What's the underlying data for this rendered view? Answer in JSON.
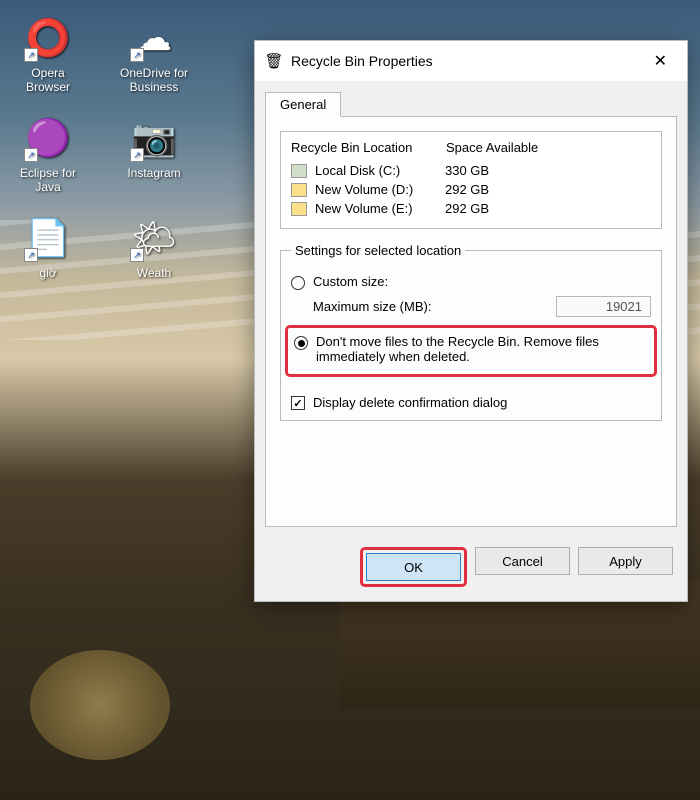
{
  "desktop": {
    "icons": [
      {
        "label": "Opera Browser",
        "glyph": "⭕"
      },
      {
        "label": "OneDrive for Business",
        "glyph": "☁"
      },
      {
        "label": "Eclipse for Java",
        "glyph": "🟣"
      },
      {
        "label": "Instagram",
        "glyph": "📷"
      },
      {
        "label": "giờ",
        "glyph": "📄"
      },
      {
        "label": "Weath",
        "glyph": "🌤"
      }
    ]
  },
  "dialog": {
    "title": "Recycle Bin Properties",
    "tab": "General",
    "locations": {
      "header_location": "Recycle Bin Location",
      "header_space": "Space Available",
      "rows": [
        {
          "name": "Local Disk (C:)",
          "space": "330 GB",
          "class": "c"
        },
        {
          "name": "New Volume (D:)",
          "space": "292 GB",
          "class": ""
        },
        {
          "name": "New Volume (E:)",
          "space": "292 GB",
          "class": ""
        }
      ]
    },
    "settings": {
      "legend": "Settings for selected location",
      "custom_size_label": "Custom size:",
      "max_size_label": "Maximum size (MB):",
      "max_size_value": "19021",
      "dont_move_label": "Don't move files to the Recycle Bin. Remove files immediately when deleted.",
      "confirm_label": "Display delete confirmation dialog"
    },
    "buttons": {
      "ok": "OK",
      "cancel": "Cancel",
      "apply": "Apply"
    }
  }
}
